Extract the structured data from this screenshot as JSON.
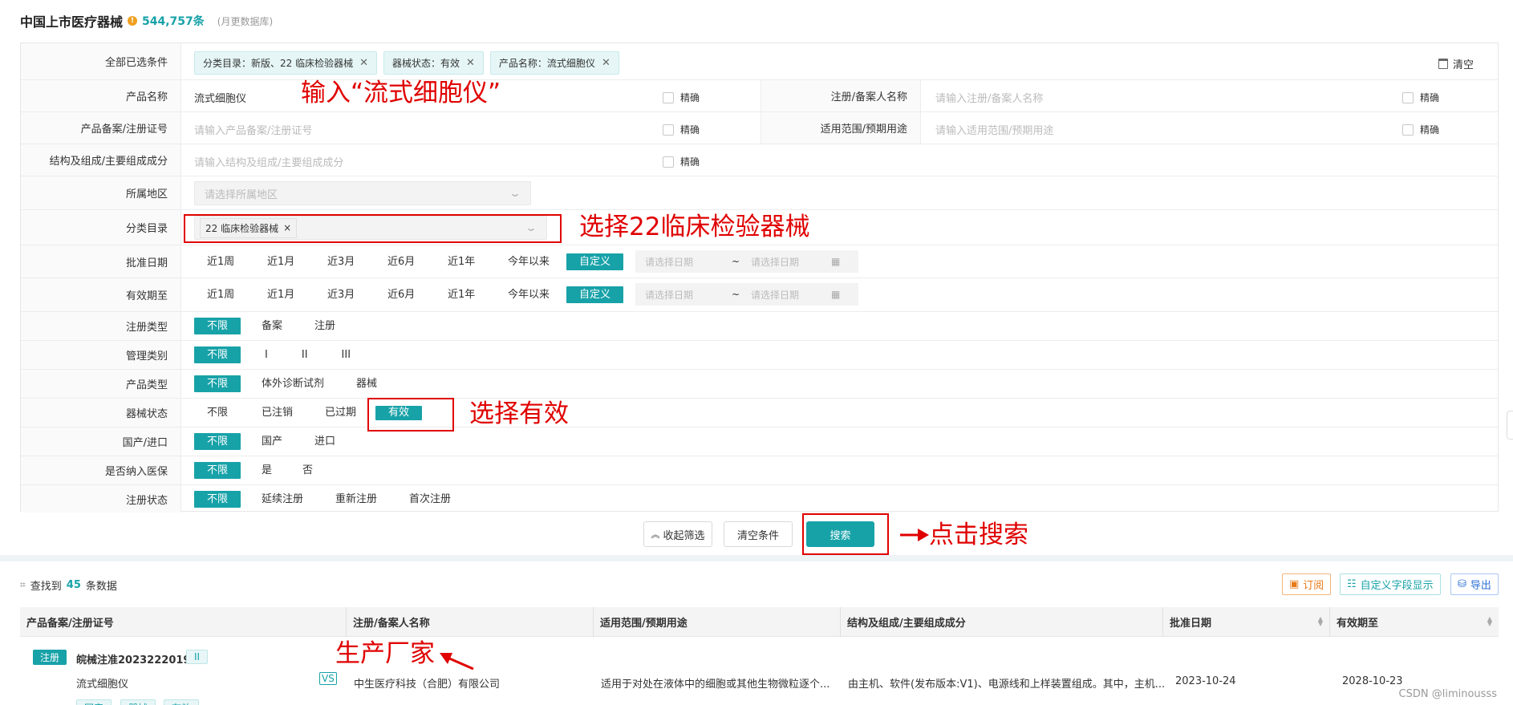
{
  "header": {
    "title": "中国上市医疗器械",
    "count": "544,757条",
    "note": "(月更数据库)"
  },
  "selected": {
    "label": "全部已选条件",
    "chips": [
      "分类目录：新版、22 临床检验器械",
      "器械状态：有效",
      "产品名称：流式细胞仪"
    ],
    "clear": "清空"
  },
  "fields": {
    "product_name": {
      "label": "产品名称",
      "value": "流式细胞仪",
      "exact": "精确"
    },
    "registrant": {
      "label": "注册/备案人名称",
      "placeholder": "请输入注册/备案人名称",
      "exact": "精确"
    },
    "reg_no": {
      "label": "产品备案/注册证号",
      "placeholder": "请输入产品备案/注册证号",
      "exact": "精确"
    },
    "scope": {
      "label": "适用范围/预期用途",
      "placeholder": "请输入适用范围/预期用途",
      "exact": "精确"
    },
    "structure": {
      "label": "结构及组成/主要组成成分",
      "placeholder": "请输入结构及组成/主要组成成分",
      "exact": "精确"
    },
    "region": {
      "label": "所属地区",
      "placeholder": "请选择所属地区"
    },
    "category": {
      "label": "分类目录",
      "tag": "22 临床检验器械"
    }
  },
  "date_presets": [
    "近1周",
    "近1月",
    "近3月",
    "近6月",
    "近1年",
    "今年以来",
    "自定义"
  ],
  "approve_date": {
    "label": "批准日期",
    "start_ph": "请选择日期",
    "sep": "~",
    "end_ph": "请选择日期"
  },
  "valid_until": {
    "label": "有效期至",
    "start_ph": "请选择日期",
    "sep": "~",
    "end_ph": "请选择日期"
  },
  "filters": {
    "reg_type": {
      "label": "注册类型",
      "options": [
        "不限",
        "备案",
        "注册"
      ]
    },
    "mgmt_class": {
      "label": "管理类别",
      "options": [
        "不限",
        "I",
        "II",
        "III"
      ]
    },
    "product_type": {
      "label": "产品类型",
      "options": [
        "不限",
        "体外诊断试剂",
        "器械"
      ]
    },
    "device_status": {
      "label": "器械状态",
      "options": [
        "不限",
        "已注销",
        "已过期",
        "有效"
      ]
    },
    "origin": {
      "label": "国产/进口",
      "options": [
        "不限",
        "国产",
        "进口"
      ]
    },
    "insurance": {
      "label": "是否纳入医保",
      "options": [
        "不限",
        "是",
        "否"
      ]
    },
    "reg_status": {
      "label": "注册状态",
      "options": [
        "不限",
        "延续注册",
        "重新注册",
        "首次注册"
      ]
    }
  },
  "actions": {
    "collapse": "收起筛选",
    "clear": "清空条件",
    "search": "搜索"
  },
  "annotations": {
    "input_name": "输入“流式细胞仪”",
    "select_category": "选择22临床检验器械",
    "select_valid": "选择有效",
    "click_search": "点击搜索",
    "manufacturer": "生产厂家"
  },
  "results": {
    "prefix": "查找到",
    "count": "45",
    "suffix": "条数据"
  },
  "tools": {
    "subscribe": "订阅",
    "custom_fields": "自定义字段显示",
    "export": "导出"
  },
  "table": {
    "columns": [
      "产品备案/注册证号",
      "注册/备案人名称",
      "适用范围/预期用途",
      "结构及组成/主要组成成分",
      "批准日期",
      "有效期至"
    ],
    "row": {
      "type_badge": "注册",
      "reg_no": "皖械注准20232220192",
      "class_badge": "II",
      "name": "流式细胞仪",
      "registrant": "中生医疗科技（合肥）有限公司",
      "scope": "适用于对处在液体中的细胞或其他生物微粒逐个...",
      "structure": "由主机、软件(发布版本:V1)、电源线和上样装置组成。其中，主机...",
      "approve_date": "2023-10-24",
      "valid_until": "2028-10-23",
      "tags": [
        "国产",
        "器械",
        "有效"
      ]
    }
  },
  "watermark": "CSDN @liminousss",
  "colors": {
    "accent": "#17a2a8",
    "annotation": "#e00000"
  }
}
